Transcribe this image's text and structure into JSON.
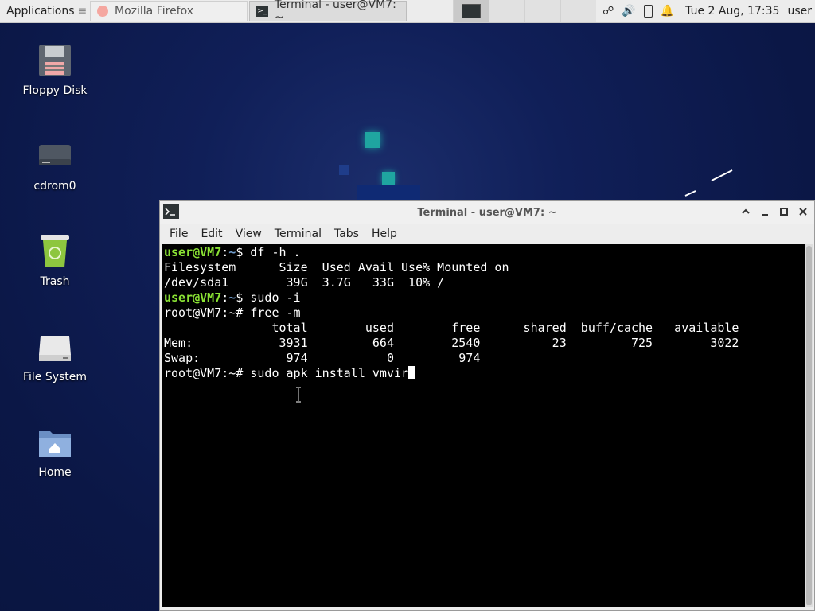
{
  "panel": {
    "applications_label": "Applications",
    "tasks": [
      {
        "label": "Mozilla Firefox"
      },
      {
        "label": "Terminal - user@VM7: ~"
      }
    ],
    "clock": "Tue  2 Aug, 17:35",
    "user": "user"
  },
  "desktop": {
    "icons": [
      {
        "label": "Floppy Disk"
      },
      {
        "label": "cdrom0"
      },
      {
        "label": "Trash"
      },
      {
        "label": "File System"
      },
      {
        "label": "Home"
      }
    ]
  },
  "terminal": {
    "title": "Terminal - user@VM7: ~",
    "menu": [
      "File",
      "Edit",
      "View",
      "Terminal",
      "Tabs",
      "Help"
    ],
    "lines": {
      "l1_user": "user@VM7",
      "l1_colon": ":",
      "l1_path": "~",
      "l1_cmd": "$ df -h .",
      "l2": "Filesystem      Size  Used Avail Use% Mounted on",
      "l3": "/dev/sda1        39G  3.7G   33G  10% /",
      "l4_user": "user@VM7",
      "l4_colon": ":",
      "l4_path": "~",
      "l4_cmd": "$ sudo -i",
      "l5": "root@VM7:~# free -m",
      "l6": "               total        used        free      shared  buff/cache   available",
      "l7": "Mem:            3931         664        2540          23         725        3022",
      "l8": "Swap:            974           0         974",
      "l9": "root@VM7:~# sudo apk install vmvir"
    }
  }
}
